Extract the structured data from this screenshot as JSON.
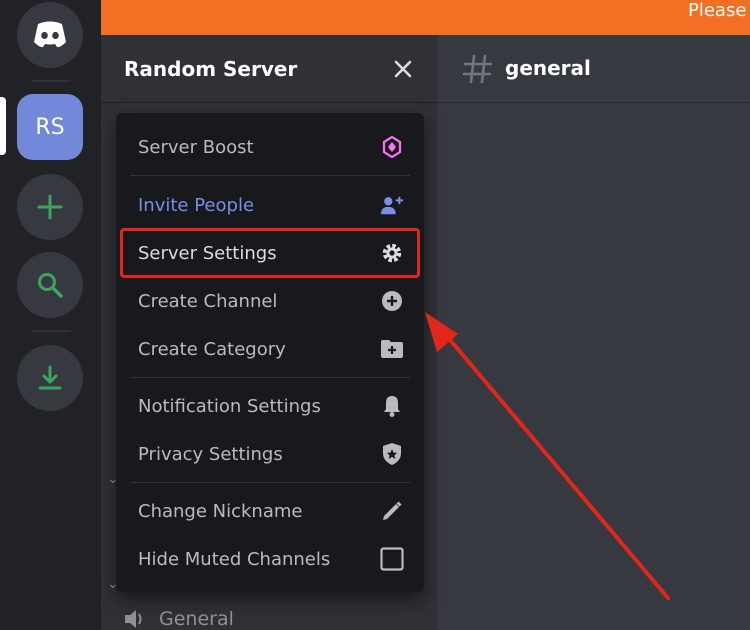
{
  "banner": {
    "text": "Please c"
  },
  "guild_bar": {
    "server_initials": "RS"
  },
  "server_header": {
    "title": "Random Server"
  },
  "chat_header": {
    "channel": "general"
  },
  "dropdown": {
    "items": [
      {
        "label": "Server Boost",
        "icon": "boost-gem-icon"
      },
      {
        "label": "Invite People",
        "icon": "invite-person-icon"
      },
      {
        "label": "Server Settings",
        "icon": "gear-icon"
      },
      {
        "label": "Create Channel",
        "icon": "plus-circle-icon"
      },
      {
        "label": "Create Category",
        "icon": "folder-plus-icon"
      },
      {
        "label": "Notification Settings",
        "icon": "bell-icon"
      },
      {
        "label": "Privacy Settings",
        "icon": "shield-star-icon"
      },
      {
        "label": "Change Nickname",
        "icon": "pencil-icon"
      },
      {
        "label": "Hide Muted Channels",
        "icon": "checkbox-icon",
        "checked": false
      }
    ]
  },
  "voice_channel": {
    "label": "General"
  },
  "colors": {
    "accent": "#f26f23",
    "highlight": "#e2261c",
    "blurple": "#7289da",
    "boost": "#ff73fa",
    "green": "#3ba55c"
  }
}
